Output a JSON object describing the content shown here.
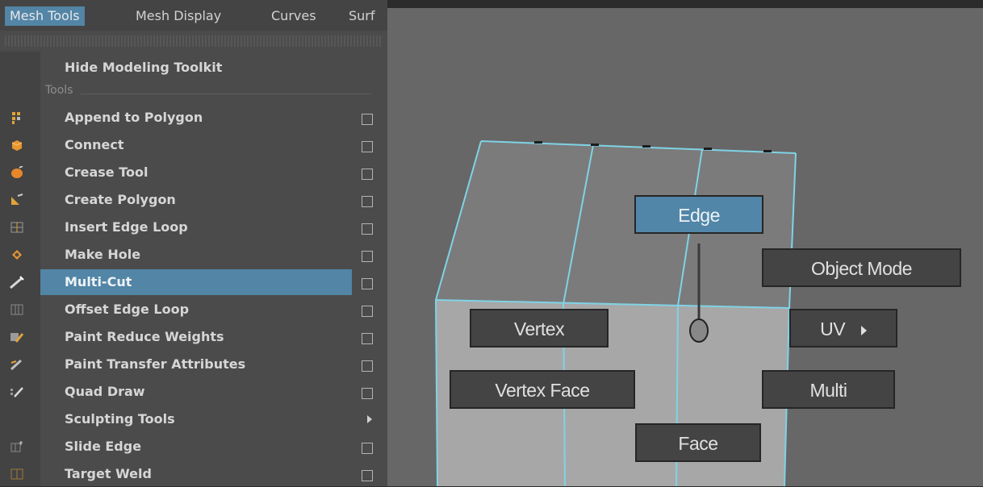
{
  "menubar": {
    "items": [
      "Mesh Tools",
      "Mesh Display",
      "Curves",
      "Surf"
    ]
  },
  "menu": {
    "hide_toolkit": "Hide Modeling Toolkit",
    "section_tools": "Tools",
    "items": [
      {
        "label": "Append to Polygon",
        "icon": "append-polygon-icon",
        "option_box": true
      },
      {
        "label": "Connect",
        "icon": "connect-icon",
        "option_box": true
      },
      {
        "label": "Crease Tool",
        "icon": "crease-icon",
        "option_box": true
      },
      {
        "label": "Create Polygon",
        "icon": "create-polygon-icon",
        "option_box": true
      },
      {
        "label": "Insert Edge Loop",
        "icon": "insert-edge-loop-icon",
        "option_box": true
      },
      {
        "label": "Make Hole",
        "icon": "make-hole-icon",
        "option_box": true
      },
      {
        "label": "Multi-Cut",
        "icon": "multi-cut-icon",
        "option_box": true,
        "highlighted": true
      },
      {
        "label": "Offset Edge Loop",
        "icon": "offset-edge-loop-icon",
        "option_box": true
      },
      {
        "label": "Paint Reduce Weights",
        "icon": "paint-reduce-weights-icon",
        "option_box": true
      },
      {
        "label": "Paint Transfer Attributes",
        "icon": "paint-transfer-icon",
        "option_box": true
      },
      {
        "label": "Quad Draw",
        "icon": "quad-draw-icon",
        "option_box": true
      },
      {
        "label": "Sculpting Tools",
        "icon": "",
        "submenu": true
      },
      {
        "label": "Slide Edge",
        "icon": "slide-edge-icon",
        "option_box": true
      },
      {
        "label": "Target Weld",
        "icon": "target-weld-icon",
        "option_box": true
      }
    ]
  },
  "marking_menu": {
    "edge": "Edge",
    "object_mode": "Object Mode",
    "vertex": "Vertex",
    "uv": "UV",
    "vertex_face": "Vertex Face",
    "multi": "Multi",
    "face": "Face"
  },
  "colors": {
    "highlight": "#5285a6",
    "wire": "#7fd3e6",
    "menu_bg": "#4b4b4b",
    "viewport_bg": "#676767"
  }
}
